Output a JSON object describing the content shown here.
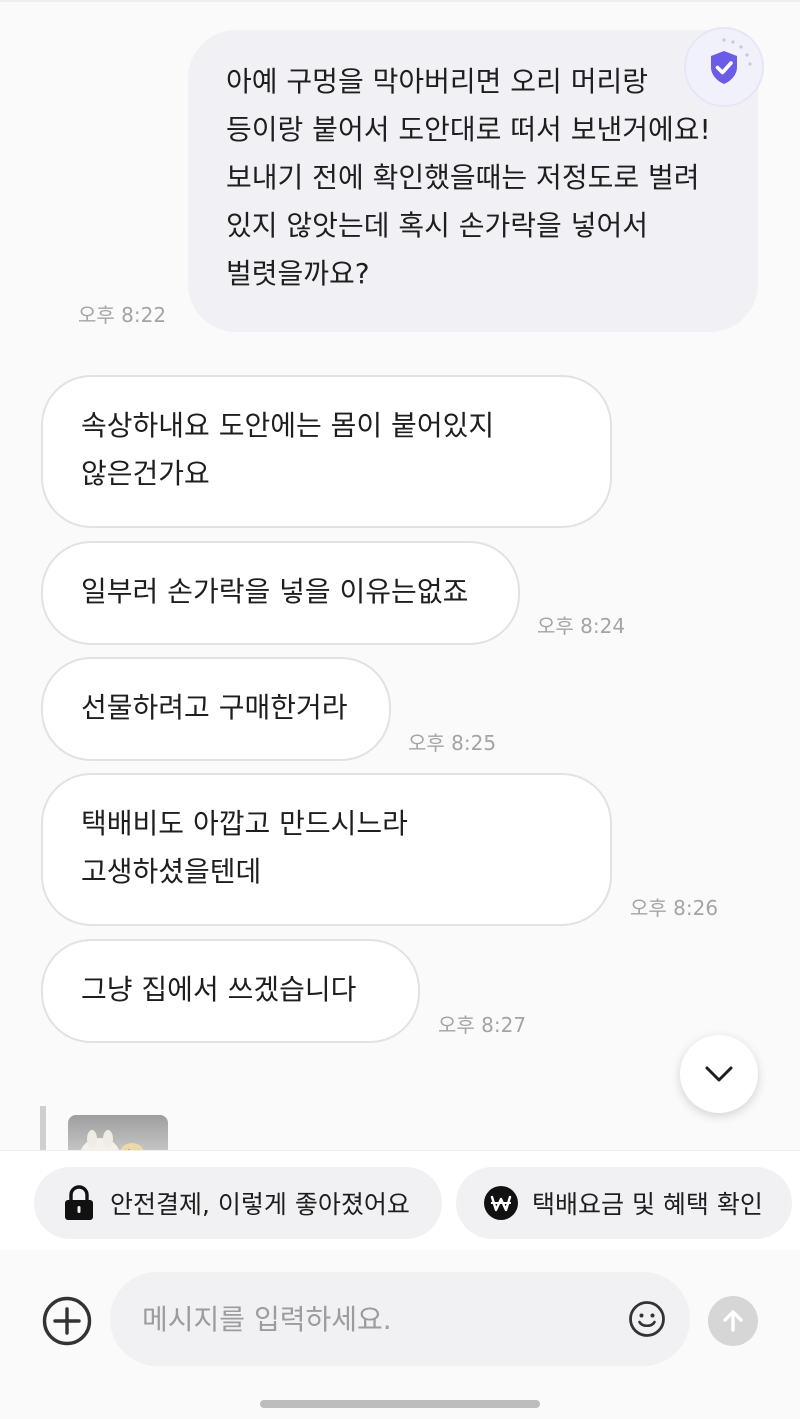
{
  "messages": {
    "m1": {
      "text": "아예 구멍을 막아버리면 오리 머리랑\n등이랑 붙어서 도안대로 떠서 보낸거에요!\n보내기 전에 확인했을때는 저정도로 벌려\n있지 않앗는데 혹시 손가락을 넣어서\n벌렷을까요?",
      "time": "오후 8:22"
    },
    "m2": {
      "text": "속상하내요  도안에는  몸이 붙어있지\n않은건가요"
    },
    "m3": {
      "text": "일부러  손가락을 넣을 이유는없죠",
      "time": "오후 8:24"
    },
    "m4": {
      "text": "선물하려고 구매한거라",
      "time": "오후 8:25"
    },
    "m5": {
      "text": "택배비도  아깝고  만드시느라\n고생하셨을텐데",
      "time": "오후 8:26"
    },
    "m6": {
      "text": "그냥   집에서  쓰겠습니다",
      "time": "오후 8:27"
    }
  },
  "promo": {
    "safe_payment": "안전결제, 이렇게 좋아졌어요",
    "shipping": "택배요금 및 혜택 확인"
  },
  "composer": {
    "placeholder": "메시지를 입력하세요."
  },
  "icons": {
    "shield": "shield-check-icon",
    "scroll": "chevron-down-icon",
    "lock": "lock-icon",
    "won": "won-icon",
    "plus": "plus-circle-icon",
    "emoji": "smiley-icon",
    "send": "arrow-up-icon"
  },
  "colors": {
    "shield_accent": "#6b5ce7",
    "my_bubble": "#f1f1f5",
    "their_bubble": "#ffffff",
    "timestamp": "#a4a4a4"
  }
}
